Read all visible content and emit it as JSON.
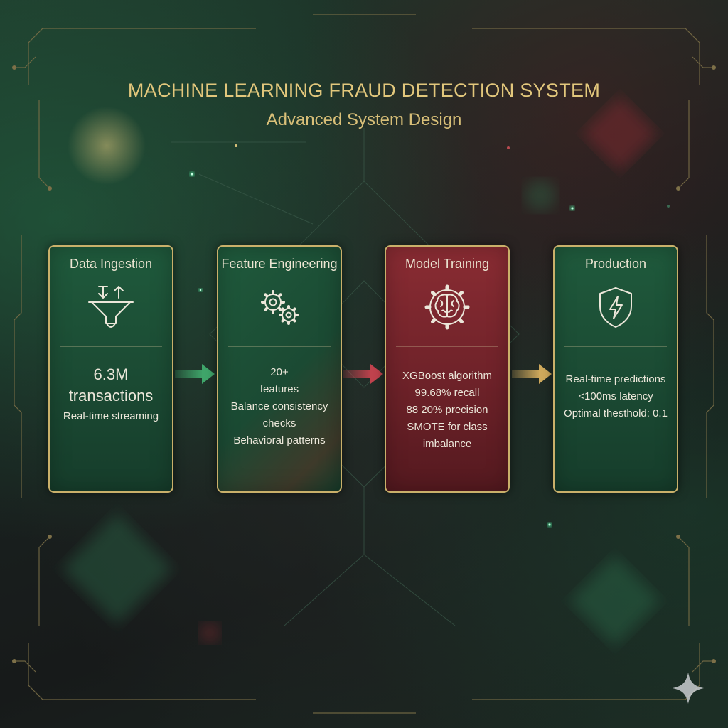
{
  "title": "MACHINE LEARNING FRAUD DETECTION SYSTEM",
  "subtitle": "Advanced System Design",
  "stages": [
    {
      "title": "Data Ingestion",
      "icon": "funnel-arrows-icon",
      "stat_lines": [
        "6.3M",
        "transactions"
      ],
      "lines": [
        "Real-time streaming"
      ]
    },
    {
      "title": "Feature Engineering",
      "icon": "gears-icon",
      "lines": [
        "20+",
        "features",
        "Balance consistency checks",
        "Behavioral patterns"
      ]
    },
    {
      "title": "Model Training",
      "icon": "brain-gear-icon",
      "lines": [
        "XGBoost algorithm",
        "99.68% recall",
        "88 20% precision",
        "SMOTE for class",
        "imbalance"
      ]
    },
    {
      "title": "Production",
      "icon": "shield-lightning-icon",
      "lines": [
        "Real-time predictions",
        "<100ms latency",
        "Optimal thesthold: 0.1"
      ]
    }
  ],
  "colors": {
    "gold": "#c9b06a",
    "title_gold": "#e2c77c",
    "card_green": "#1b4a33",
    "card_red": "#6e2229",
    "arrow_green": "#3fa56a",
    "arrow_red": "#c0424d",
    "arrow_gold": "#cfa95c"
  }
}
